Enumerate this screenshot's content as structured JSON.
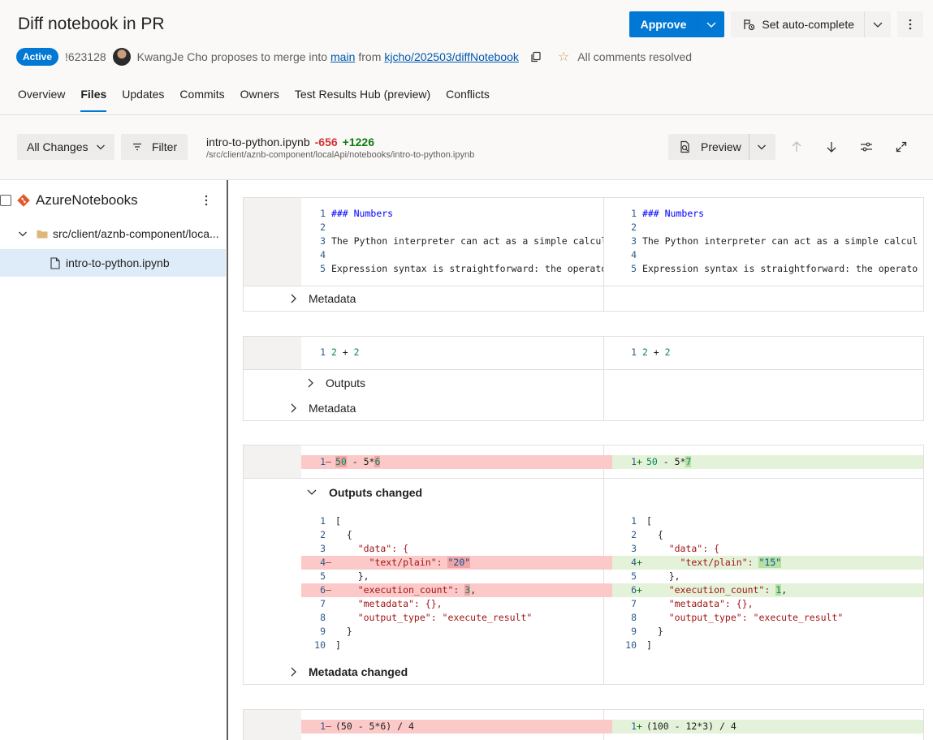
{
  "header": {
    "title": "Diff notebook in PR",
    "approve_label": "Approve",
    "autocomplete_label": "Set auto-complete",
    "status_badge": "Active",
    "pr_id": "!623128",
    "author": "KwangJe Cho",
    "proposes_text": "proposes to merge into",
    "target_branch": "main",
    "from_text": "from",
    "source_branch": "kjcho/202503/diffNotebook",
    "comments_status": "All comments resolved"
  },
  "tabs": [
    "Overview",
    "Files",
    "Updates",
    "Commits",
    "Owners",
    "Test Results Hub (preview)",
    "Conflicts"
  ],
  "toolbar": {
    "all_changes_label": "All Changes",
    "filter_label": "Filter",
    "file_name": "intro-to-python.ipynb",
    "deletions": "-656",
    "additions": "+1226",
    "file_path": "/src/client/aznb-component/localApi/notebooks/intro-to-python.ipynb",
    "preview_label": "Preview"
  },
  "sidebar": {
    "repo_name": "AzureNotebooks",
    "folder": "src/client/aznb-component/loca...",
    "file": "intro-to-python.ipynb"
  },
  "cells": {
    "c1": {
      "left": [
        {
          "n": "1",
          "t": "### Numbers"
        },
        {
          "n": "2",
          "t": ""
        },
        {
          "n": "3",
          "t": "The Python interpreter can act as a simple calcul"
        },
        {
          "n": "4",
          "t": ""
        },
        {
          "n": "5",
          "t": "Expression syntax is straightforward: the operato"
        }
      ],
      "right": [
        {
          "n": "1",
          "t": "### Numbers"
        },
        {
          "n": "2",
          "t": ""
        },
        {
          "n": "3",
          "t": "The Python interpreter can act as a simple calcul"
        },
        {
          "n": "4",
          "t": ""
        },
        {
          "n": "5",
          "t": "Expression syntax is straightforward: the operato"
        }
      ],
      "metadata_label": "Metadata"
    },
    "c2": {
      "left_n": "1",
      "right_n": "1",
      "code_a": "2",
      "code_op": " + ",
      "code_b": "2",
      "outputs_label": "Outputs",
      "metadata_label": "Metadata"
    },
    "c3": {
      "left_n": "1",
      "right_n": "1",
      "left_a": "50",
      "left_op": " - 5*",
      "left_b": "6",
      "right_a": "50",
      "right_op": " - 5*",
      "right_b": "7",
      "outputs_changed_label": "Outputs changed",
      "metadata_changed_label": "Metadata changed",
      "json_lines": [
        {
          "n": "1",
          "t": "["
        },
        {
          "n": "2",
          "t": "  {"
        },
        {
          "n": "3",
          "t": "    \"data\": {"
        },
        {
          "n": "4",
          "t": "      \"text/plain\": "
        },
        {
          "n": "5",
          "t": "    },"
        },
        {
          "n": "6",
          "t": "    \"execution_count\": "
        },
        {
          "n": "7",
          "t": "    \"metadata\": {},"
        },
        {
          "n": "8",
          "t": "    \"output_type\": \"execute_result\""
        },
        {
          "n": "9",
          "t": "  }"
        },
        {
          "n": "10",
          "t": "]"
        }
      ],
      "left_text_plain": "\"20\"",
      "right_text_plain": "\"15\"",
      "left_exec_count": "3",
      "right_exec_count": "1"
    },
    "c4": {
      "left_n": "1",
      "right_n": "1",
      "left_code": "(50 - 5*6) / 4",
      "right_code": "(100 - 12*3) / 4"
    }
  },
  "icons": {
    "approve_dropdown": "chevron-down-icon",
    "autocomplete": "autocomplete-icon",
    "more": "more-icon",
    "copy": "copy-icon",
    "follow": "star-icon",
    "filter": "filter-icon",
    "preview": "preview-icon",
    "up": "arrow-up-icon",
    "down": "arrow-down-icon",
    "settings": "settings-icon",
    "expand": "expand-icon"
  },
  "colors": {
    "accent": "#0078d4",
    "deletion": "#d13438",
    "addition": "#107c10",
    "del_bg": "#fcc9c9",
    "add_bg": "#e3f2d9"
  }
}
